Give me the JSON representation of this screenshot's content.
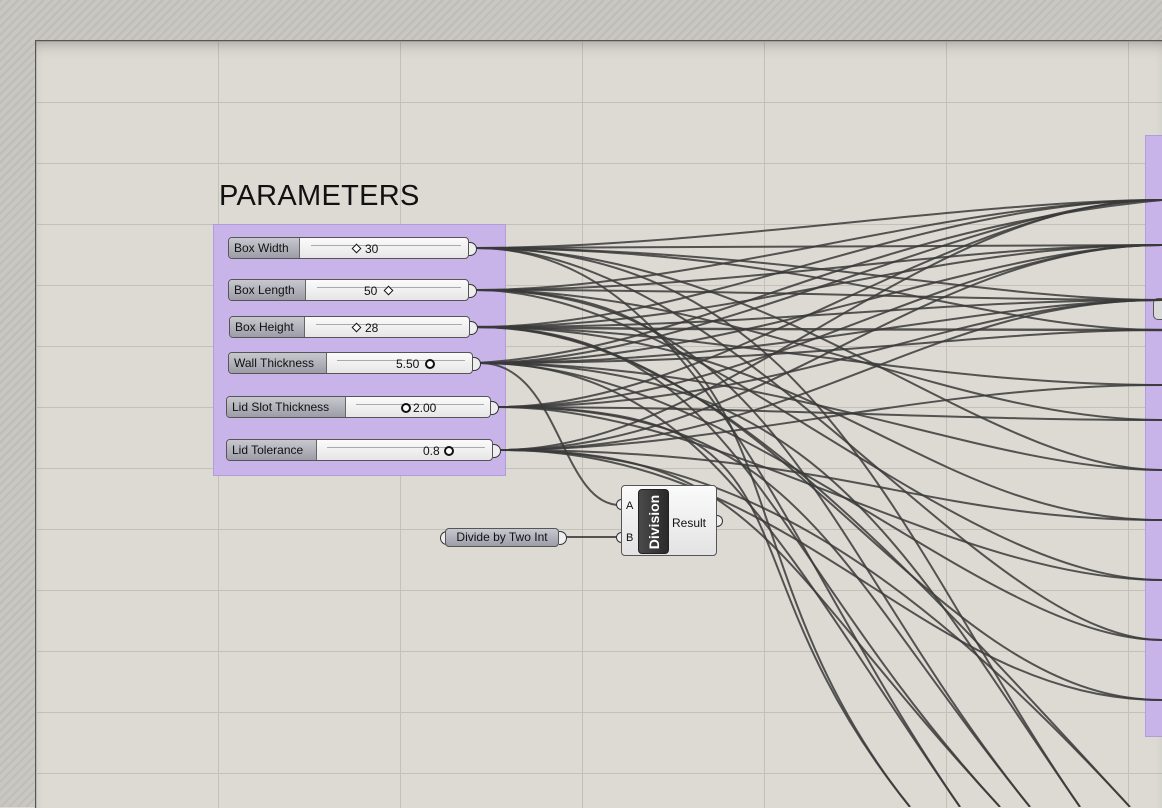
{
  "group": {
    "title": "PARAMETERS"
  },
  "sliders": [
    {
      "label": "Box Width",
      "value": "30"
    },
    {
      "label": "Box Length",
      "value": "50"
    },
    {
      "label": "Box Height",
      "value": "28"
    },
    {
      "label": "Wall Thickness",
      "value": "5.50"
    },
    {
      "label": "Lid Slot Thickness",
      "value": "2.00"
    },
    {
      "label": "Lid Tolerance",
      "value": "0.8"
    }
  ],
  "divide_param": {
    "label": "Divide by Two Int"
  },
  "division": {
    "name": "Division",
    "input_a": "A",
    "input_b": "B",
    "output": "Result"
  },
  "colors": {
    "canvas": "#dddad3",
    "group": "#c9b4ea",
    "wire": "#3a3a3a"
  }
}
